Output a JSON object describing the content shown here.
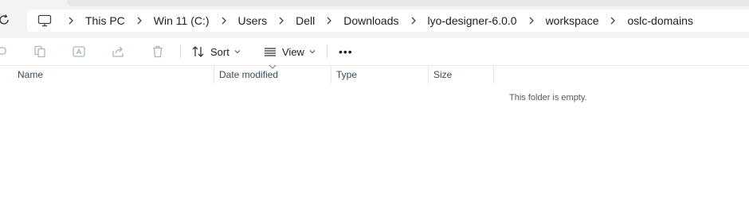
{
  "breadcrumb": {
    "items": [
      {
        "label": "This PC"
      },
      {
        "label": "Win 11 (C:)"
      },
      {
        "label": "Users"
      },
      {
        "label": "Dell"
      },
      {
        "label": "Downloads"
      },
      {
        "label": "lyo-designer-6.0.0"
      },
      {
        "label": "workspace"
      },
      {
        "label": "oslc-domains"
      }
    ]
  },
  "toolbar": {
    "sort_label": "Sort",
    "view_label": "View",
    "more_label": "•••"
  },
  "columns": [
    "Name",
    "Date modified",
    "Type",
    "Size"
  ],
  "empty_message": "This folder is empty.",
  "icons": {
    "refresh": "refresh-icon",
    "pc": "monitor-icon",
    "separator": "chevron-right-icon",
    "rename": "rename-icon",
    "copy": "copy-icon",
    "ai": "ai-text-icon",
    "share": "share-icon",
    "delete": "trash-icon",
    "sort": "sort-icon",
    "view": "view-lines-icon",
    "more": "more-icon"
  },
  "colors": {
    "chrome": "#f3f3f3",
    "disabled_icon": "#a9b4c3",
    "header_text": "#3c4a5c"
  }
}
